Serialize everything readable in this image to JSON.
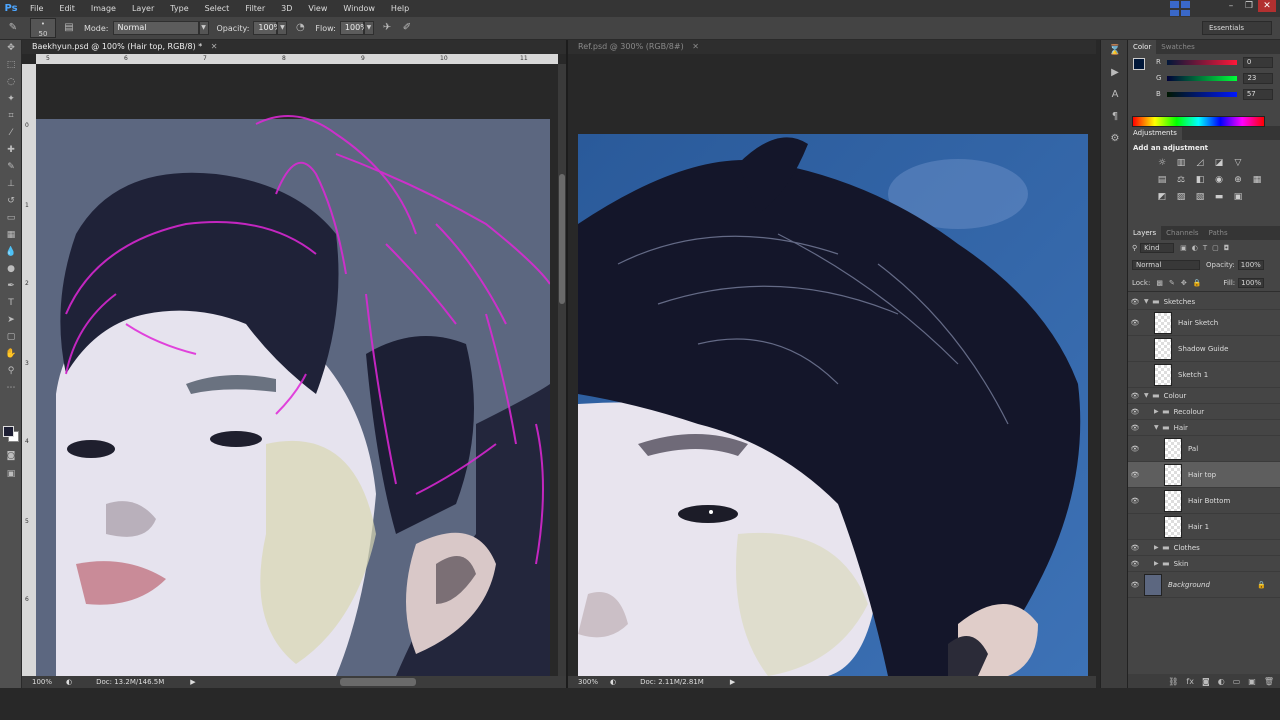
{
  "app": {
    "logo": "Ps"
  },
  "menu": [
    "File",
    "Edit",
    "Image",
    "Layer",
    "Type",
    "Select",
    "Filter",
    "3D",
    "View",
    "Window",
    "Help"
  ],
  "window_controls": {
    "minimize": "–",
    "restore": "❐",
    "close": "✕"
  },
  "options_bar": {
    "brush_size": "50",
    "mode_label": "Mode:",
    "mode_value": "Normal",
    "opacity_label": "Opacity:",
    "opacity_value": "100%",
    "flow_label": "Flow:",
    "flow_value": "100%",
    "workspace": "Essentials"
  },
  "documents": [
    {
      "tab_title": "Baekhyun.psd @ 100% (Hair top, RGB/8) *",
      "zoom": "100%",
      "doc_size": "Doc: 13.2M/146.5M",
      "ruler_h": [
        "5",
        "6",
        "7",
        "8",
        "9",
        "10",
        "11"
      ],
      "ruler_v": [
        "0",
        "1",
        "2",
        "3",
        "4",
        "5",
        "6"
      ]
    },
    {
      "tab_title": "Ref.psd @ 300% (RGB/8#)",
      "zoom": "300%",
      "doc_size": "Doc: 2.11M/2.81M"
    }
  ],
  "color_panel": {
    "tabs": [
      "Color",
      "Swatches"
    ],
    "channels": [
      {
        "label": "R",
        "value": "0"
      },
      {
        "label": "G",
        "value": "23"
      },
      {
        "label": "B",
        "value": "57"
      }
    ],
    "foreground": "#001739"
  },
  "adjustments_panel": {
    "title": "Adjustments",
    "subtitle": "Add an adjustment"
  },
  "layers_panel": {
    "tabs": [
      "Layers",
      "Channels",
      "Paths"
    ],
    "filter_label": "Kind",
    "blend_mode": "Normal",
    "opacity_label": "Opacity:",
    "opacity_value": "100%",
    "lock_label": "Lock:",
    "fill_label": "Fill:",
    "fill_value": "100%",
    "layers": [
      {
        "name": "Sketches",
        "type": "group",
        "depth": 0,
        "visible": true,
        "open": true
      },
      {
        "name": "Hair Sketch",
        "type": "layer",
        "depth": 1,
        "visible": true
      },
      {
        "name": "Shadow Guide",
        "type": "layer",
        "depth": 1,
        "visible": false
      },
      {
        "name": "Sketch 1",
        "type": "layer",
        "depth": 1,
        "visible": false
      },
      {
        "name": "Colour",
        "type": "group",
        "depth": 0,
        "visible": true,
        "open": true
      },
      {
        "name": "Recolour",
        "type": "group",
        "depth": 1,
        "visible": true,
        "open": false
      },
      {
        "name": "Hair",
        "type": "group",
        "depth": 1,
        "visible": true,
        "open": true
      },
      {
        "name": "Pal",
        "type": "layer",
        "depth": 2,
        "visible": true
      },
      {
        "name": "Hair top",
        "type": "layer",
        "depth": 2,
        "visible": true,
        "selected": true
      },
      {
        "name": "Hair Bottom",
        "type": "layer",
        "depth": 2,
        "visible": true
      },
      {
        "name": "Hair 1",
        "type": "layer",
        "depth": 2,
        "visible": false
      },
      {
        "name": "Clothes",
        "type": "group",
        "depth": 1,
        "visible": true,
        "open": false
      },
      {
        "name": "Skin",
        "type": "group",
        "depth": 1,
        "visible": true,
        "open": false
      },
      {
        "name": "Background",
        "type": "background",
        "depth": 0,
        "visible": true,
        "locked": true
      }
    ]
  }
}
